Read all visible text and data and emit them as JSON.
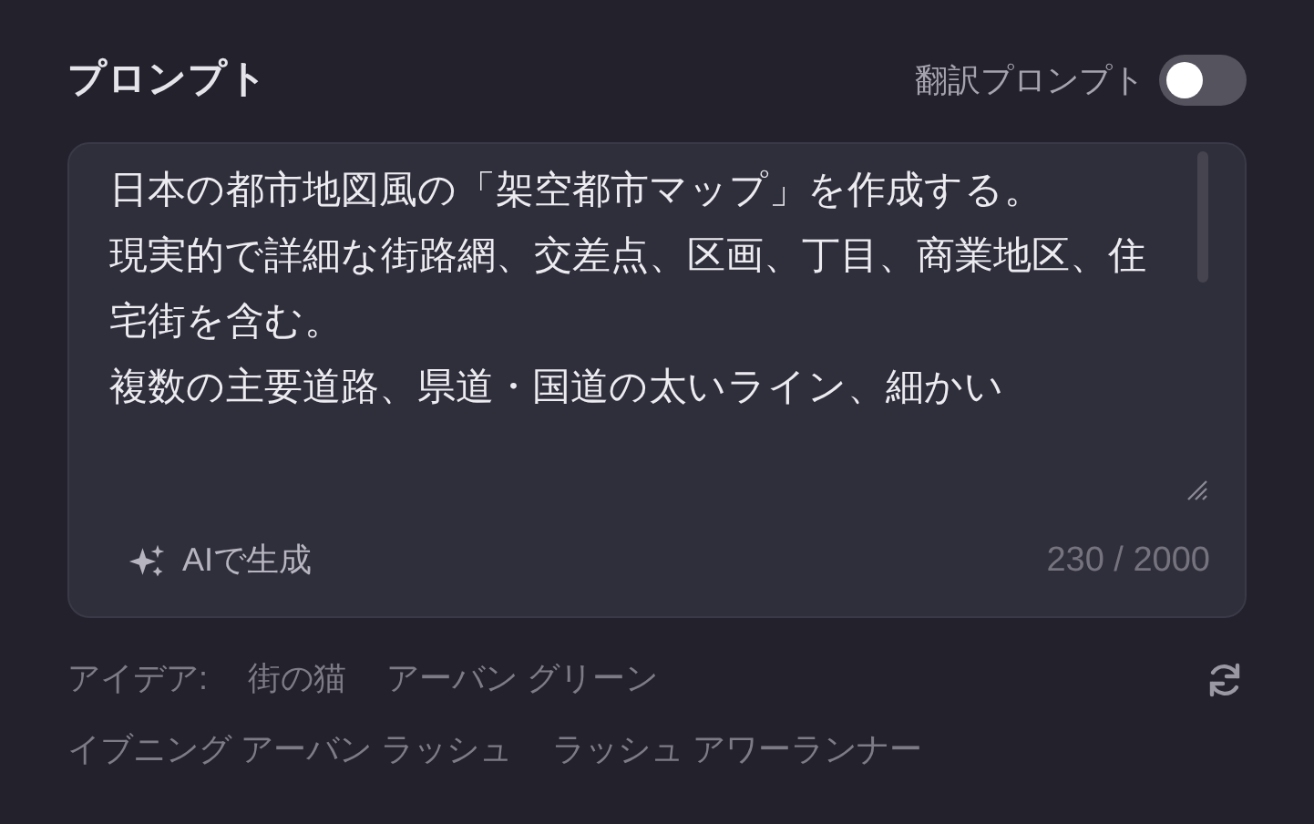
{
  "title": "プロンプト",
  "translate_toggle": {
    "label": "翻訳プロンプト",
    "on": false
  },
  "prompt": {
    "paragraphs": [
      "日本の都市地図風の「架空都市マップ」を作成する。",
      "現実的で詳細な街路網、交差点、区画、丁目、商業地区、住宅街を含む。",
      "複数の主要道路、県道・国道の太いライン、細かい"
    ],
    "counter": "230 / 2000"
  },
  "generate_button": {
    "label": "AIで生成"
  },
  "ideas": {
    "label": "アイデア:",
    "items": [
      "街の猫",
      "アーバン グリーン",
      "イブニング アーバン ラッシュ",
      "ラッシュ アワーランナー"
    ]
  }
}
